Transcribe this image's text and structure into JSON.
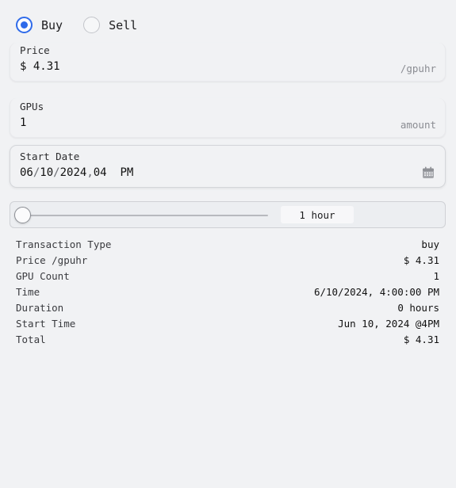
{
  "trade_type": {
    "options": [
      {
        "label": "Buy",
        "checked": true
      },
      {
        "label": "Sell",
        "checked": false
      }
    ]
  },
  "price_field": {
    "label": "Price",
    "value": "$ 4.31",
    "unit": "/gpuhr"
  },
  "gpus_field": {
    "label": "GPUs",
    "value": "1",
    "unit": "amount"
  },
  "start_date_field": {
    "label": "Start Date",
    "month": "06",
    "day": "10",
    "year": "2024",
    "hour": "04",
    "ampm": "PM",
    "icon": "calendar-icon"
  },
  "duration_slider": {
    "value_label": "1 hour",
    "level": 0
  },
  "summary": {
    "rows": [
      {
        "label": "Transaction Type",
        "value": "buy"
      },
      {
        "label": "Price /gpuhr",
        "value": "$ 4.31"
      },
      {
        "label": "GPU Count",
        "value": "1"
      },
      {
        "label": "Time",
        "value": "6/10/2024, 4:00:00 PM"
      },
      {
        "label": "Duration",
        "value": "0 hours"
      },
      {
        "label": "Start Time",
        "value": "Jun 10, 2024 @4PM"
      },
      {
        "label": "Total",
        "value": "$ 4.31"
      }
    ]
  },
  "colors": {
    "accent": "#2f6bea",
    "background": "#f1f2f4"
  }
}
